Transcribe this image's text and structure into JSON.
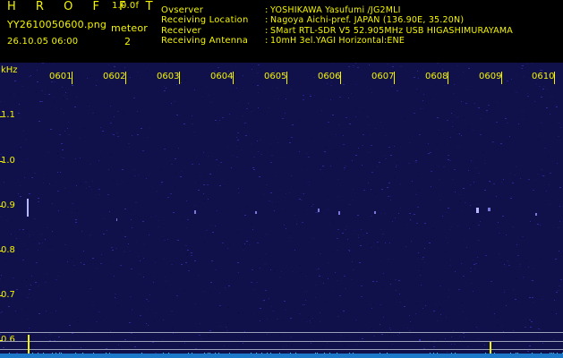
{
  "header": {
    "app_title": "H R O F F T",
    "version": "1.0.0f",
    "filename": "YY2610050600.png",
    "datetime": "26.10.05 06:00",
    "meteor_label": "meteor",
    "meteor_count": "2",
    "info": [
      {
        "label": "Ovserver",
        "value": "YOSHIKAWA Yasufumi /JG2MLI"
      },
      {
        "label": "Receiving Location",
        "value": "Nagoya Aichi-pref. JAPAN (136.90E, 35.20N)"
      },
      {
        "label": "Receiver",
        "value": "SMart RTL-SDR V5 52.905MHz USB HIGASHIMURAYAMA"
      },
      {
        "label": "Receiving Antenna",
        "value": "10mH 3el.YAGI Horizontal:ENE"
      }
    ],
    "separator": ":"
  },
  "spectrogram": {
    "unit": "kHz",
    "minutes": [
      "0601",
      "0602",
      "0603",
      "0604",
      "0605",
      "0606",
      "0607",
      "0608",
      "0609",
      "0610"
    ],
    "freq_labels": [
      "1.1",
      "1.0",
      "0.9",
      "0.8",
      "0.7",
      "0.6"
    ],
    "colors": {
      "background": "#10104a",
      "labels": "#f4f400",
      "meteor": "#b8b8ff",
      "strip": "#1c78c8"
    }
  }
}
